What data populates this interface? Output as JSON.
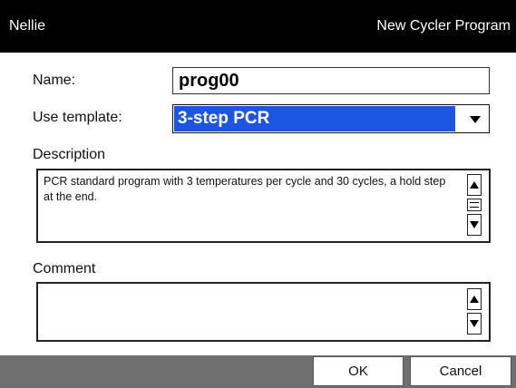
{
  "titlebar": {
    "app": "Nellie",
    "window": "New Cycler Program"
  },
  "form": {
    "name_label": "Name:",
    "name_value": "prog00",
    "template_label": "Use template:",
    "template_value": "3-step PCR",
    "description_label": "Description",
    "description_text": "PCR standard program with 3 temperatures per cycle and 30 cycles, a hold step at the end.",
    "comment_label": "Comment",
    "comment_text": ""
  },
  "buttons": {
    "ok": "OK",
    "cancel": "Cancel"
  },
  "colors": {
    "titlebar": "#000000",
    "selection": "#1c56e0",
    "footer": "#6f6f6f"
  },
  "icons": {
    "dropdown": "triangle-down-icon",
    "scroll_up": "triangle-up-icon",
    "scroll_down": "triangle-down-icon"
  }
}
